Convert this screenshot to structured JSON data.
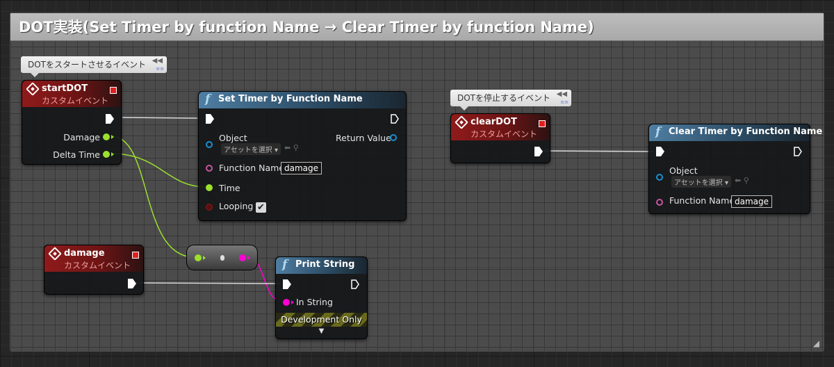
{
  "comment": {
    "title": "DOT実装(Set Timer by function Name → Clear Timer by function Name)"
  },
  "bubbles": {
    "start_note": "DOTをスタートさせるイベント",
    "stop_note": "DOTを停止するイベント"
  },
  "nodes": {
    "start_dot": {
      "title": "startDOT",
      "subtitle": "カスタムイベント",
      "pin_damage": "Damage",
      "pin_delta": "Delta Time"
    },
    "damage_event": {
      "title": "damage",
      "subtitle": "カスタムイベント"
    },
    "set_timer": {
      "title": "Set Timer by Function Name",
      "pin_object": "Object",
      "object_select": "アセットを選択",
      "pin_return": "Return Value",
      "pin_function_name": "Function Name",
      "function_name_value": "damage",
      "pin_time": "Time",
      "pin_looping": "Looping",
      "looping_checked": true
    },
    "print_string": {
      "title": "Print String",
      "pin_in_string": "In String",
      "dev_only": "Development Only"
    },
    "clear_dot": {
      "title": "clearDOT",
      "subtitle": "カスタムイベント"
    },
    "clear_timer": {
      "title": "Clear Timer by Function Name",
      "pin_object": "Object",
      "object_select": "アセットを選択",
      "pin_function_name": "Function Name",
      "function_name_value": "damage"
    }
  },
  "colors": {
    "float_pin": "#9be02e",
    "string_pin": "#ff00d4",
    "name_pin": "#c8569c",
    "object_pin": "#1a8fd0",
    "bool_pin": "#8a1a1a",
    "exec": "#ffffff"
  },
  "icons": [
    "custom-event-icon",
    "function-icon",
    "delegate-icon",
    "pin-icon",
    "dropdown-arrow-icon",
    "expand-arrow-icon"
  ]
}
